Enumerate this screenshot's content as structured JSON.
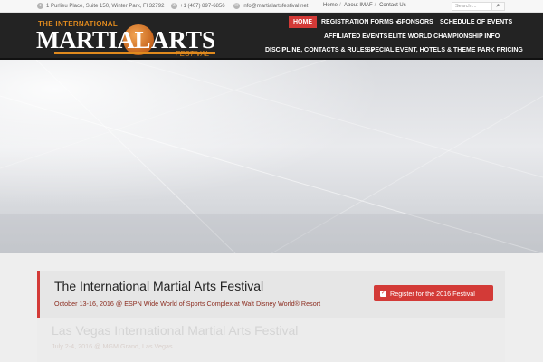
{
  "topbar": {
    "address": "1 Purlieu Place, Suite 150, Winter Park, Fl 32792",
    "phone": "+1 (407) 897-6856",
    "email": "info@martialartsfestival.net",
    "links": [
      "Home",
      "About IMAF",
      "Contact Us"
    ],
    "search_placeholder": "Search ..."
  },
  "logo": {
    "line1": "THE INTERNATIONAL",
    "word1": "MARTIAL",
    "word2": "ARTS",
    "line3": "FESTIVAL"
  },
  "nav": {
    "home": "HOME",
    "registration": "REGISTRATION FORMS",
    "sponsors": "SPONSORS",
    "schedule": "SCHEDULE OF EVENTS",
    "affiliated": "AFFILIATED EVENTS",
    "elite": "ELITE WORLD CHAMPIONSHIP INFO",
    "discipline": "DISCIPLINE, CONTACTS & RULES",
    "special": "SPECIAL EVENT, HOTELS & THEME PARK PRICING"
  },
  "events": [
    {
      "title": "The International Martial Arts Festival",
      "subtitle": "October 13-16, 2016 @ ESPN Wide World of Sports Complex at Walt Disney World® Resort",
      "button": "Register for the 2016 Festival"
    },
    {
      "title": "Las Vegas International Martial Arts Festival",
      "subtitle": "July 2-4, 2016 @ MGM Grand, Las Vegas"
    }
  ],
  "colors": {
    "accent": "#d33a37",
    "header_bg": "#232323",
    "logo_orange": "#e08a1e"
  },
  "icons": {
    "address": "location-icon",
    "phone": "phone-icon",
    "email": "mail-icon",
    "search": "search-icon",
    "register": "checkbox-icon"
  }
}
